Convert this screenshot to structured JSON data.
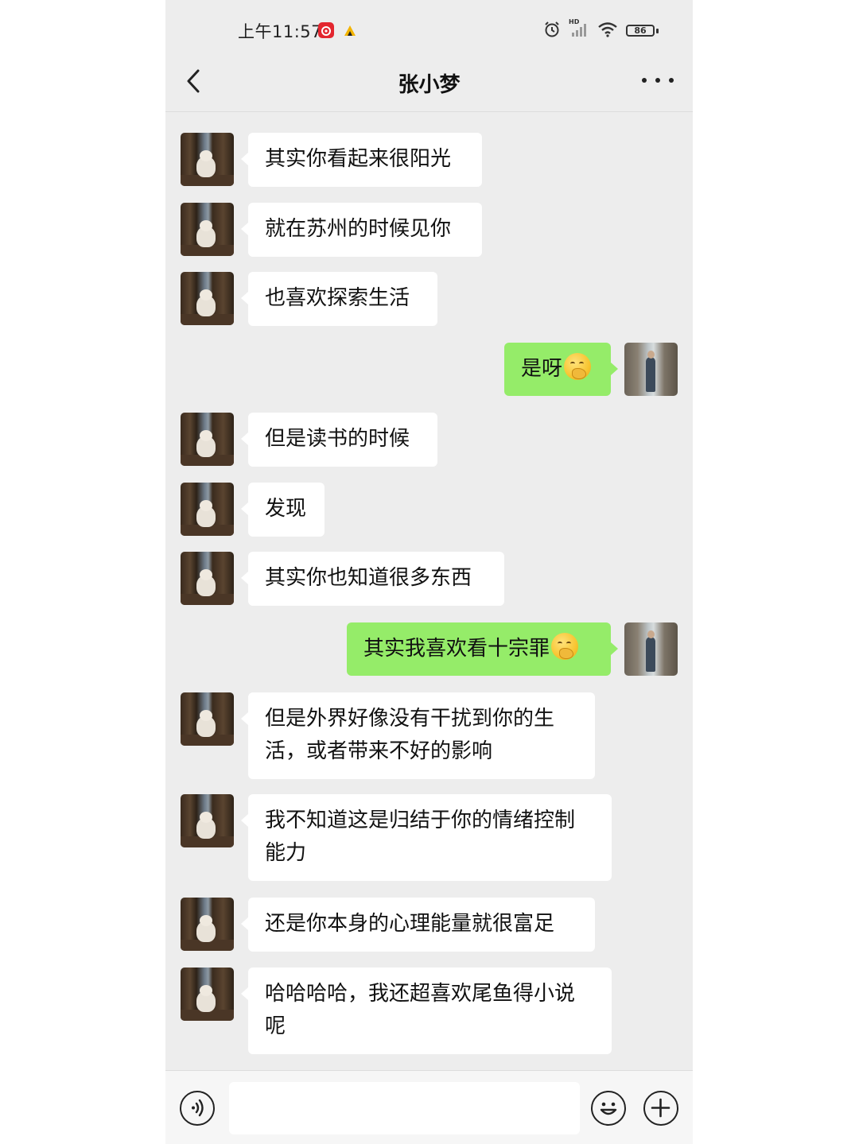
{
  "status_bar": {
    "time": "上午11:57",
    "battery": "86",
    "network": "HD"
  },
  "header": {
    "title": "张小梦"
  },
  "messages": [
    {
      "side": "left",
      "text": "其实你看起来很阳光"
    },
    {
      "side": "left",
      "text": "就在苏州的时候见你"
    },
    {
      "side": "left",
      "text": "也喜欢探索生活"
    },
    {
      "side": "right",
      "text": "是呀",
      "emoji": "thinking-face"
    },
    {
      "side": "left",
      "text": "但是读书的时候"
    },
    {
      "side": "left",
      "text": "发现"
    },
    {
      "side": "left",
      "text": "其实你也知道很多东西"
    },
    {
      "side": "right",
      "text": "其实我喜欢看十宗罪",
      "emoji": "thinking-face"
    },
    {
      "side": "left",
      "text": "但是外界好像没有干扰到你的生活，或者带来不好的影响"
    },
    {
      "side": "left",
      "text": "我不知道这是归结于你的情绪控制能力"
    },
    {
      "side": "left",
      "text": "还是你本身的心理能量就很富足"
    },
    {
      "side": "left",
      "text": "哈哈哈哈，我还超喜欢尾鱼得小说呢"
    }
  ],
  "input_bar": {
    "voice_icon": "voice-icon",
    "emoji_icon": "smile-icon",
    "plus_icon": "plus-icon",
    "value": ""
  },
  "colors": {
    "background": "#ededed",
    "outgoing_bubble": "#95ec69",
    "incoming_bubble": "#ffffff"
  }
}
